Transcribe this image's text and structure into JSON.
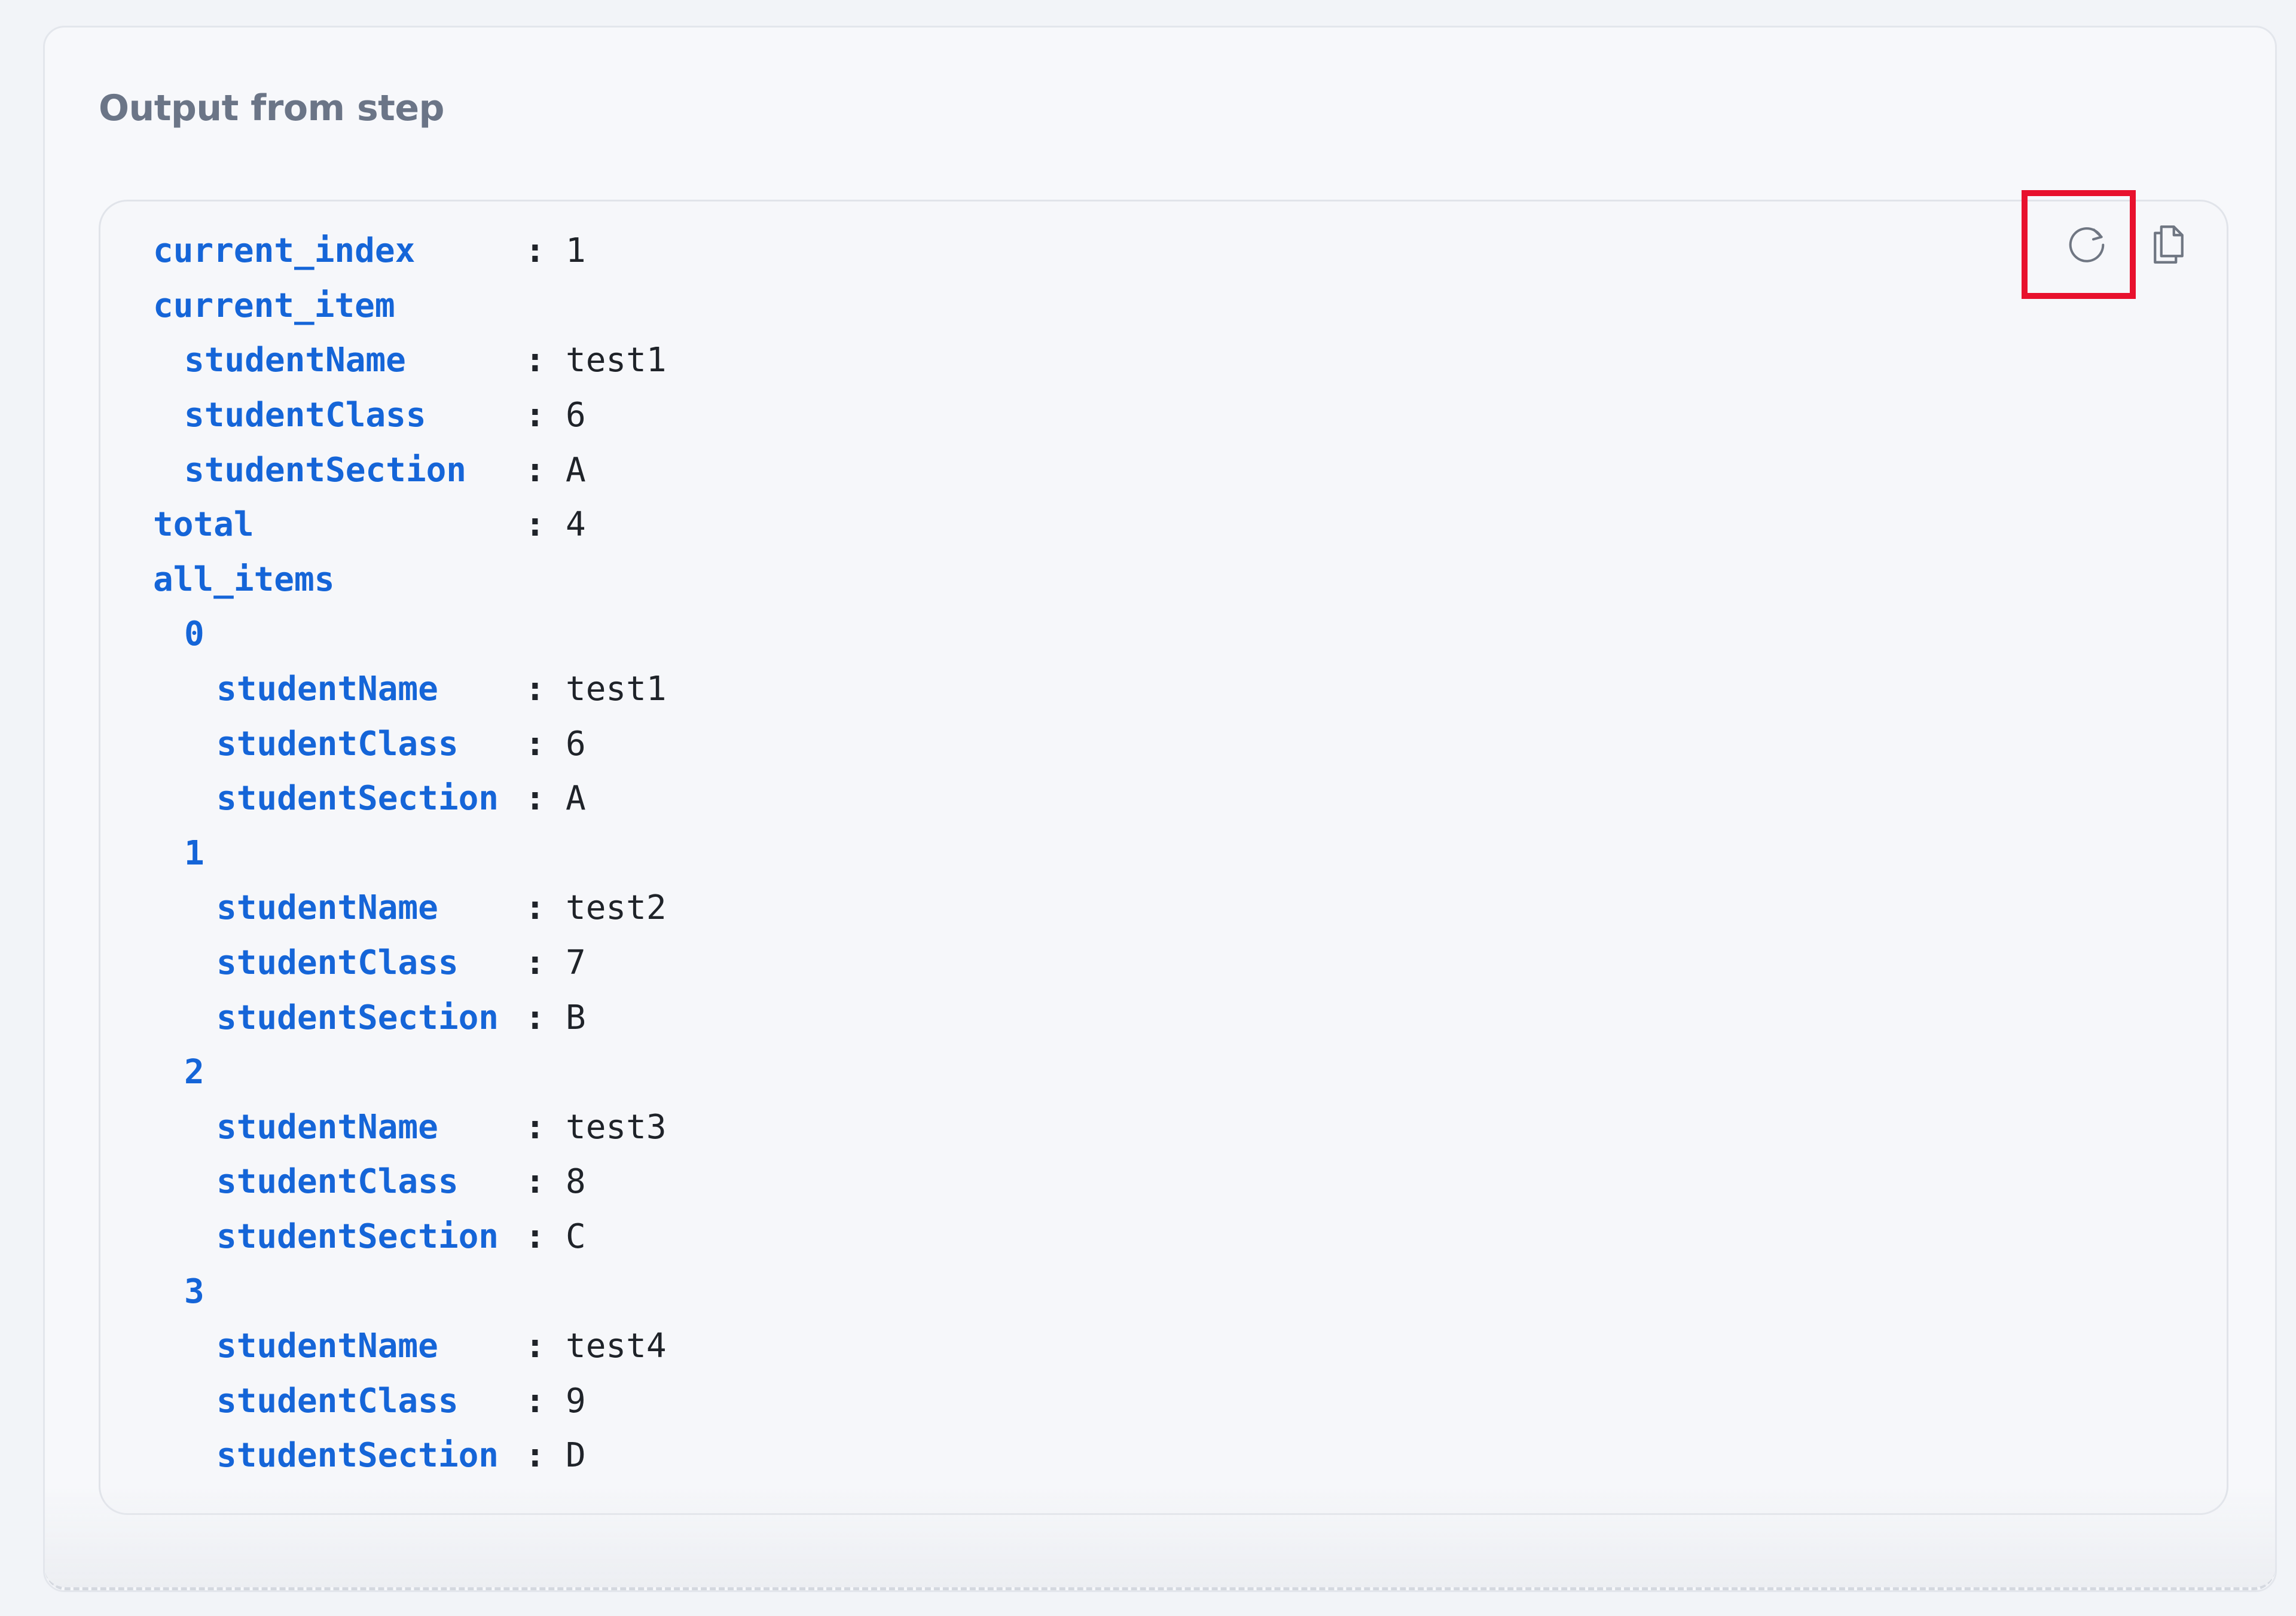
{
  "panel": {
    "title": "Output from step"
  },
  "toolbar": {
    "refresh_icon": "refresh-icon",
    "copy_icon": "copy-icon",
    "highlight_color": "#e8112d"
  },
  "output": {
    "separator": ":",
    "lines": [
      {
        "key": "current_index",
        "value": "1",
        "indent": 0
      },
      {
        "key": "current_item",
        "value": null,
        "indent": 0
      },
      {
        "key": "studentName",
        "value": "test1",
        "indent": 1
      },
      {
        "key": "studentClass",
        "value": "6",
        "indent": 1
      },
      {
        "key": "studentSection",
        "value": "A",
        "indent": 1
      },
      {
        "key": "total",
        "value": "4",
        "indent": 0
      },
      {
        "key": "all_items",
        "value": null,
        "indent": 0
      },
      {
        "key": "0",
        "value": null,
        "indent": 1
      },
      {
        "key": "studentName",
        "value": "test1",
        "indent": 2
      },
      {
        "key": "studentClass",
        "value": "6",
        "indent": 2
      },
      {
        "key": "studentSection",
        "value": "A",
        "indent": 2
      },
      {
        "key": "1",
        "value": null,
        "indent": 1
      },
      {
        "key": "studentName",
        "value": "test2",
        "indent": 2
      },
      {
        "key": "studentClass",
        "value": "7",
        "indent": 2
      },
      {
        "key": "studentSection",
        "value": "B",
        "indent": 2
      },
      {
        "key": "2",
        "value": null,
        "indent": 1
      },
      {
        "key": "studentName",
        "value": "test3",
        "indent": 2
      },
      {
        "key": "studentClass",
        "value": "8",
        "indent": 2
      },
      {
        "key": "studentSection",
        "value": "C",
        "indent": 2
      },
      {
        "key": "3",
        "value": null,
        "indent": 1
      },
      {
        "key": "studentName",
        "value": "test4",
        "indent": 2
      },
      {
        "key": "studentClass",
        "value": "9",
        "indent": 2
      },
      {
        "key": "studentSection",
        "value": "D",
        "indent": 2
      }
    ]
  }
}
